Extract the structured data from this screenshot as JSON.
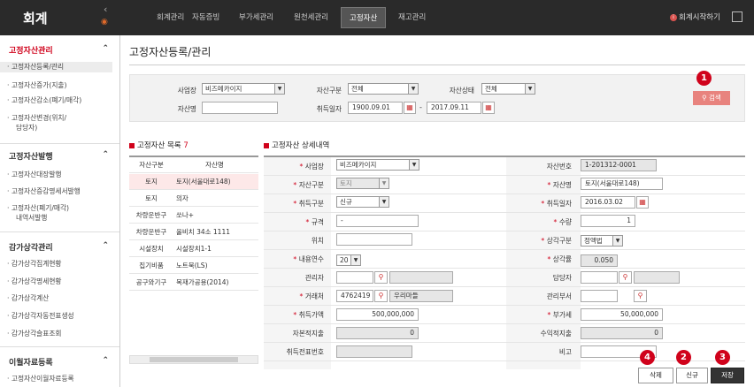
{
  "app": {
    "title": "회계",
    "hamburger": "☰"
  },
  "nav": [
    "회계관리",
    "자동증빙",
    "부가세관리",
    "원천세관리",
    "고정자산",
    "재고관리"
  ],
  "nav_active_index": 4,
  "header_right": {
    "start_label": "회계시작하기",
    "info_icon": "info-icon"
  },
  "sidebar": {
    "sections": [
      {
        "title": "고정자산관리",
        "items": [
          "고정자산등록/관리",
          "고정자산증가(지출)",
          "고정자산감소(폐기/매각)",
          "고정자산변경(위치/",
          "담당자)"
        ]
      },
      {
        "title": "고정자산발행",
        "items": [
          "고정자산대장발행",
          "고정자산증감명세서발행",
          "고정자산(폐기/매각)",
          "내역서발행"
        ]
      },
      {
        "title": "감가상각관리",
        "items": [
          "감가상각집계현황",
          "감가상각명세현황",
          "감가상각계산",
          "감가상각자동전표생성",
          "감가상각슬표조회"
        ]
      },
      {
        "title": "이월자료등록",
        "items": [
          "고정자산이월자료등록"
        ]
      }
    ]
  },
  "page": {
    "title": "고정자산등록/관리"
  },
  "filter": {
    "business_label": "사업장",
    "business_value": "비즈메카이지",
    "asset_type_label": "자산구분",
    "asset_type_value": "전체",
    "asset_status_label": "자산상태",
    "asset_status_value": "전체",
    "asset_name_label": "자산명",
    "asset_name_value": "",
    "acq_date_label": "취득일자",
    "date_from": "1900.09.01",
    "date_sep": "-",
    "date_to": "2017.09.11",
    "search_label": "검색"
  },
  "list": {
    "title": "고정자산 목록",
    "count": "7",
    "headers": [
      "자산구분",
      "자산명"
    ],
    "rows": [
      [
        "토지",
        "토지(서울대로148)"
      ],
      [
        "토지",
        "의자"
      ],
      [
        "차량운반구",
        "쏘나+"
      ],
      [
        "차량운반구",
        "올비치 34소 1111"
      ],
      [
        "시설장치",
        "시설장치1-1"
      ],
      [
        "집기비품",
        "노트북(LS)"
      ],
      [
        "공구와기구",
        "목재가공용(2014)"
      ]
    ]
  },
  "detail": {
    "title": "고정자산 상세내역",
    "required_mark": "*",
    "business_label": "사업장",
    "business_value": "비즈메카이지",
    "asset_no_label": "자산번호",
    "asset_no_value": "1-201312-0001",
    "asset_type_label": "자산구분",
    "asset_type_value": "토지",
    "asset_name_label": "자산명",
    "asset_name_value": "토지(서울대로148)",
    "acq_type_label": "취득구분",
    "acq_type_value": "신규",
    "acq_date_label": "취득일자",
    "acq_date_value": "2016.03.02",
    "spec_label": "규격",
    "spec_value": "-",
    "qty_label": "수량",
    "qty_value": "1",
    "location_label": "위치",
    "location_value": "",
    "dep_type_label": "상각구분",
    "dep_type_value": "정액법",
    "life_label": "내용연수",
    "life_value": "20",
    "dep_rate_label": "상각률",
    "dep_rate_value": "0.050",
    "manager_label": "관리자",
    "manager_value": "",
    "owner_label": "담당자",
    "owner_value": "",
    "vendor_label": "거래처",
    "vendor_code": "4762419",
    "vendor_name": "우리마들",
    "dept_label": "관리부서",
    "dept_value": "",
    "acq_amount_label": "취득가액",
    "acq_amount_value": "500,000,000",
    "vat_label": "부가세",
    "vat_value": "50,000,000",
    "capex_label": "자본적지출",
    "capex_value": "0",
    "revenue_exp_label": "수익적지출",
    "revenue_exp_value": "0",
    "voucher_label": "취득전표번호",
    "voucher_value": "",
    "note_label": "비고",
    "note_value": ""
  },
  "actions": {
    "delete_label": "삭제",
    "new_label": "신규",
    "save_label": "저장"
  },
  "badges": {
    "search": "1",
    "new": "2",
    "save": "3",
    "delete": "4"
  },
  "colors": {
    "accent": "#d0021b",
    "topbar": "#2a2a2a",
    "search_button": "#e8837e"
  }
}
